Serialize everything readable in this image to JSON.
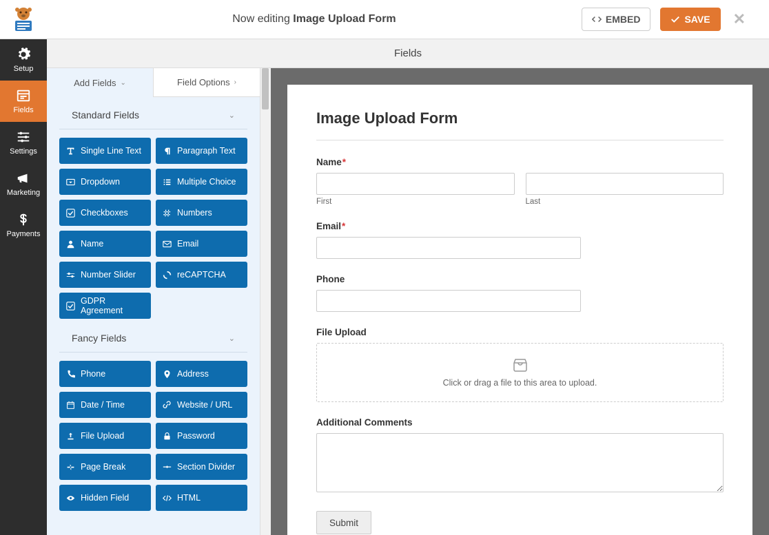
{
  "header": {
    "now_editing": "Now editing",
    "form_name": "Image Upload Form",
    "embed": "EMBED",
    "save": "SAVE"
  },
  "nav": {
    "setup": "Setup",
    "fields": "Fields",
    "settings": "Settings",
    "marketing": "Marketing",
    "payments": "Payments"
  },
  "fields_header": "Fields",
  "tabs": {
    "add_fields": "Add Fields",
    "field_options": "Field Options"
  },
  "sections": {
    "standard": "Standard Fields",
    "fancy": "Fancy Fields"
  },
  "standard_fields": [
    {
      "icon": "text",
      "label": "Single Line Text"
    },
    {
      "icon": "para",
      "label": "Paragraph Text"
    },
    {
      "icon": "caret",
      "label": "Dropdown"
    },
    {
      "icon": "list",
      "label": "Multiple Choice"
    },
    {
      "icon": "check",
      "label": "Checkboxes"
    },
    {
      "icon": "hash",
      "label": "Numbers"
    },
    {
      "icon": "user",
      "label": "Name"
    },
    {
      "icon": "mail",
      "label": "Email"
    },
    {
      "icon": "slider",
      "label": "Number Slider"
    },
    {
      "icon": "recap",
      "label": "reCAPTCHA"
    },
    {
      "icon": "check",
      "label": "GDPR Agreement"
    }
  ],
  "fancy_fields": [
    {
      "icon": "phone",
      "label": "Phone"
    },
    {
      "icon": "pin",
      "label": "Address"
    },
    {
      "icon": "cal",
      "label": "Date / Time"
    },
    {
      "icon": "link",
      "label": "Website / URL"
    },
    {
      "icon": "upload",
      "label": "File Upload"
    },
    {
      "icon": "lock",
      "label": "Password"
    },
    {
      "icon": "break",
      "label": "Page Break"
    },
    {
      "icon": "divider",
      "label": "Section Divider"
    },
    {
      "icon": "eye",
      "label": "Hidden Field"
    },
    {
      "icon": "code",
      "label": "HTML"
    }
  ],
  "form": {
    "title": "Image Upload Form",
    "name_label": "Name",
    "first": "First",
    "last": "Last",
    "email_label": "Email",
    "phone_label": "Phone",
    "upload_label": "File Upload",
    "upload_text": "Click or drag a file to this area to upload.",
    "comments_label": "Additional Comments",
    "submit": "Submit"
  }
}
